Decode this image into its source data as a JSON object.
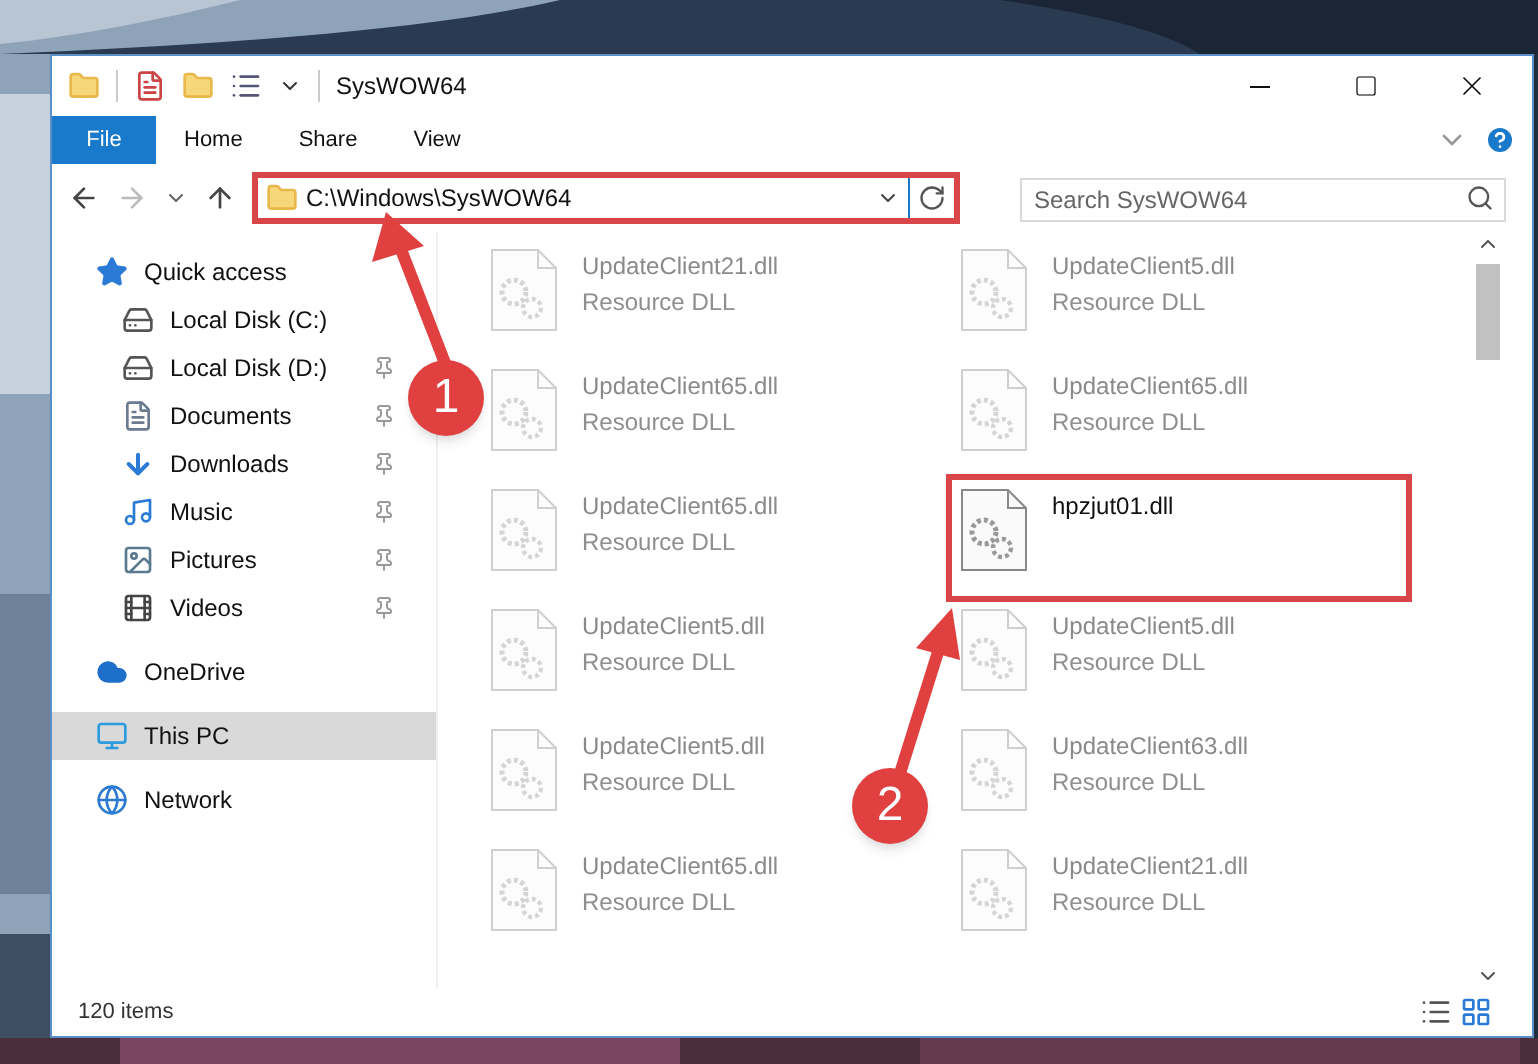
{
  "window": {
    "title": "SysWOW64"
  },
  "ribbon_tabs": [
    {
      "label": "File",
      "selected": true
    },
    {
      "label": "Home",
      "selected": false
    },
    {
      "label": "Share",
      "selected": false
    },
    {
      "label": "View",
      "selected": false
    }
  ],
  "address": {
    "path": "C:\\Windows\\SysWOW64",
    "highlighted": true
  },
  "search": {
    "placeholder": "Search SysWOW64"
  },
  "nav": [
    {
      "label": "Quick access",
      "selected": false,
      "children": [
        {
          "label": "Local Disk (C:)",
          "pinned": false
        },
        {
          "label": "Local Disk (D:)",
          "pinned": true
        },
        {
          "label": "Documents",
          "pinned": true
        },
        {
          "label": "Downloads",
          "pinned": true
        },
        {
          "label": "Music",
          "pinned": true
        },
        {
          "label": "Pictures",
          "pinned": true
        },
        {
          "label": "Videos",
          "pinned": true
        }
      ]
    },
    {
      "label": "OneDrive",
      "selected": false
    },
    {
      "label": "This PC",
      "selected": true
    },
    {
      "label": "Network",
      "selected": false
    }
  ],
  "files": [
    {
      "name": "UpdateClient21.dll",
      "type": "Resource DLL",
      "highlighted": false
    },
    {
      "name": "UpdateClient5.dll",
      "type": "Resource DLL",
      "highlighted": false
    },
    {
      "name": "UpdateClient65.dll",
      "type": "Resource DLL",
      "highlighted": false
    },
    {
      "name": "UpdateClient65.dll",
      "type": "Resource DLL",
      "highlighted": false
    },
    {
      "name": "UpdateClient65.dll",
      "type": "Resource DLL",
      "highlighted": false
    },
    {
      "name": "hpzjut01.dll",
      "highlighted": true
    },
    {
      "name": "UpdateClient5.dll",
      "type": "Resource DLL",
      "highlighted": false
    },
    {
      "name": "UpdateClient5.dll",
      "type": "Resource DLL",
      "highlighted": false
    },
    {
      "name": "UpdateClient5.dll",
      "type": "Resource DLL",
      "highlighted": false
    },
    {
      "name": "UpdateClient63.dll",
      "type": "Resource DLL",
      "highlighted": false
    },
    {
      "name": "UpdateClient65.dll",
      "type": "Resource DLL",
      "highlighted": false
    },
    {
      "name": "UpdateClient21.dll",
      "type": "Resource DLL",
      "highlighted": false
    }
  ],
  "status_bar": {
    "count": "120 items"
  },
  "annotations": [
    {
      "label": "1"
    },
    {
      "label": "2"
    }
  ]
}
